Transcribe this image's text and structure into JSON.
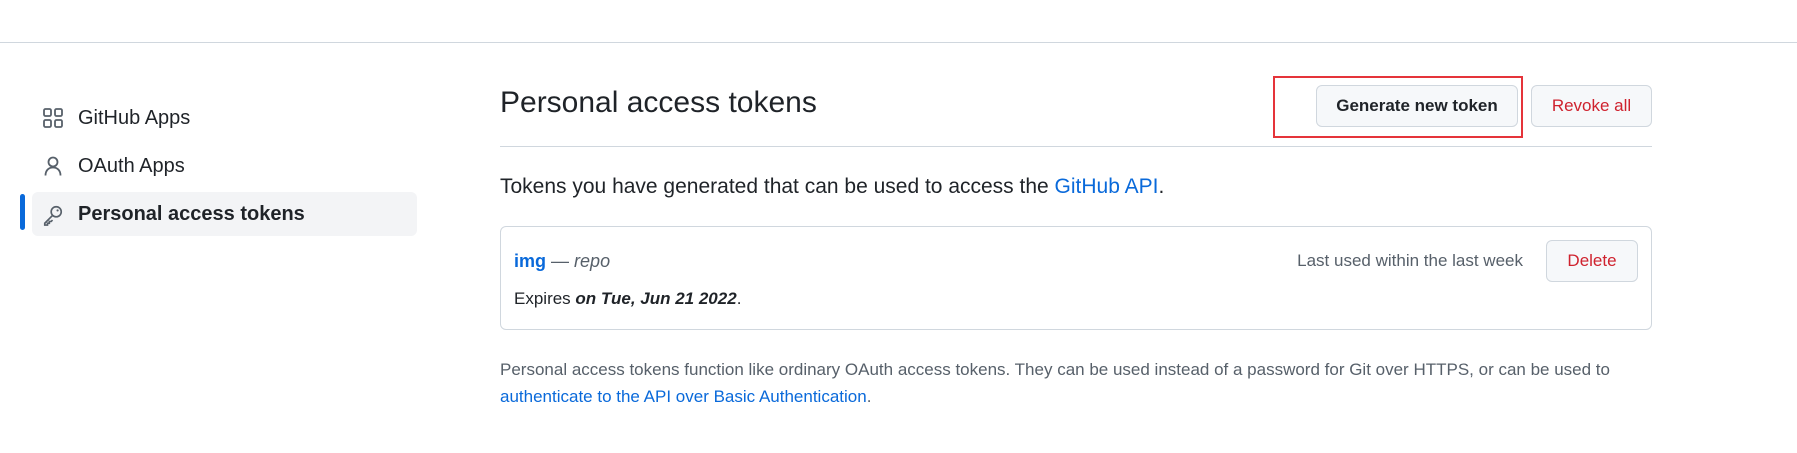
{
  "sidebar": {
    "items": [
      {
        "label": "GitHub Apps",
        "icon": "apps-grid-icon",
        "active": false
      },
      {
        "label": "OAuth Apps",
        "icon": "person-icon",
        "active": false
      },
      {
        "label": "Personal access tokens",
        "icon": "key-icon",
        "active": true
      }
    ]
  },
  "main": {
    "title": "Personal access tokens",
    "generate_button": "Generate new token",
    "revoke_button": "Revoke all",
    "description_prefix": "Tokens you have generated that can be used to access the ",
    "description_link": "GitHub API",
    "description_suffix": ".",
    "token": {
      "name": "img",
      "separator": "—",
      "scope": "repo",
      "expires_prefix": "Expires ",
      "expires_date": "on Tue, Jun 21 2022",
      "expires_suffix": ".",
      "last_used": "Last used within the last week",
      "delete_button": "Delete"
    },
    "note_text": "Personal access tokens function like ordinary OAuth access tokens. They can be used instead of a password for Git over HTTPS, or can be used to ",
    "note_link": "authenticate to the API over Basic Authentication",
    "note_suffix": "."
  },
  "colors": {
    "accent": "#0969da",
    "danger": "#cf222e",
    "highlight": "#e5343a"
  }
}
